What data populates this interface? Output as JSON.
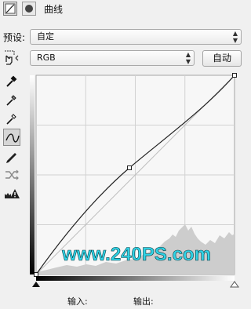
{
  "header": {
    "title": "曲线"
  },
  "preset": {
    "label": "预设:",
    "value": "自定"
  },
  "channel": {
    "value": "RGB"
  },
  "auto_button": {
    "label": "自动"
  },
  "watermark": {
    "text": "www.240PS.com",
    "color": "#2fd3e6"
  },
  "footer": {
    "input_label": "输入:",
    "output_label": "输出:"
  },
  "curve": {
    "points": [
      [
        0,
        0
      ],
      [
        102,
        124
      ],
      [
        255,
        255
      ]
    ]
  },
  "tools": [
    "eyedropper-black-icon",
    "eyedropper-gray-icon",
    "eyedropper-white-icon",
    "curve-edit-icon",
    "pencil-icon",
    "smooth-icon",
    "clipping-warning-icon"
  ]
}
